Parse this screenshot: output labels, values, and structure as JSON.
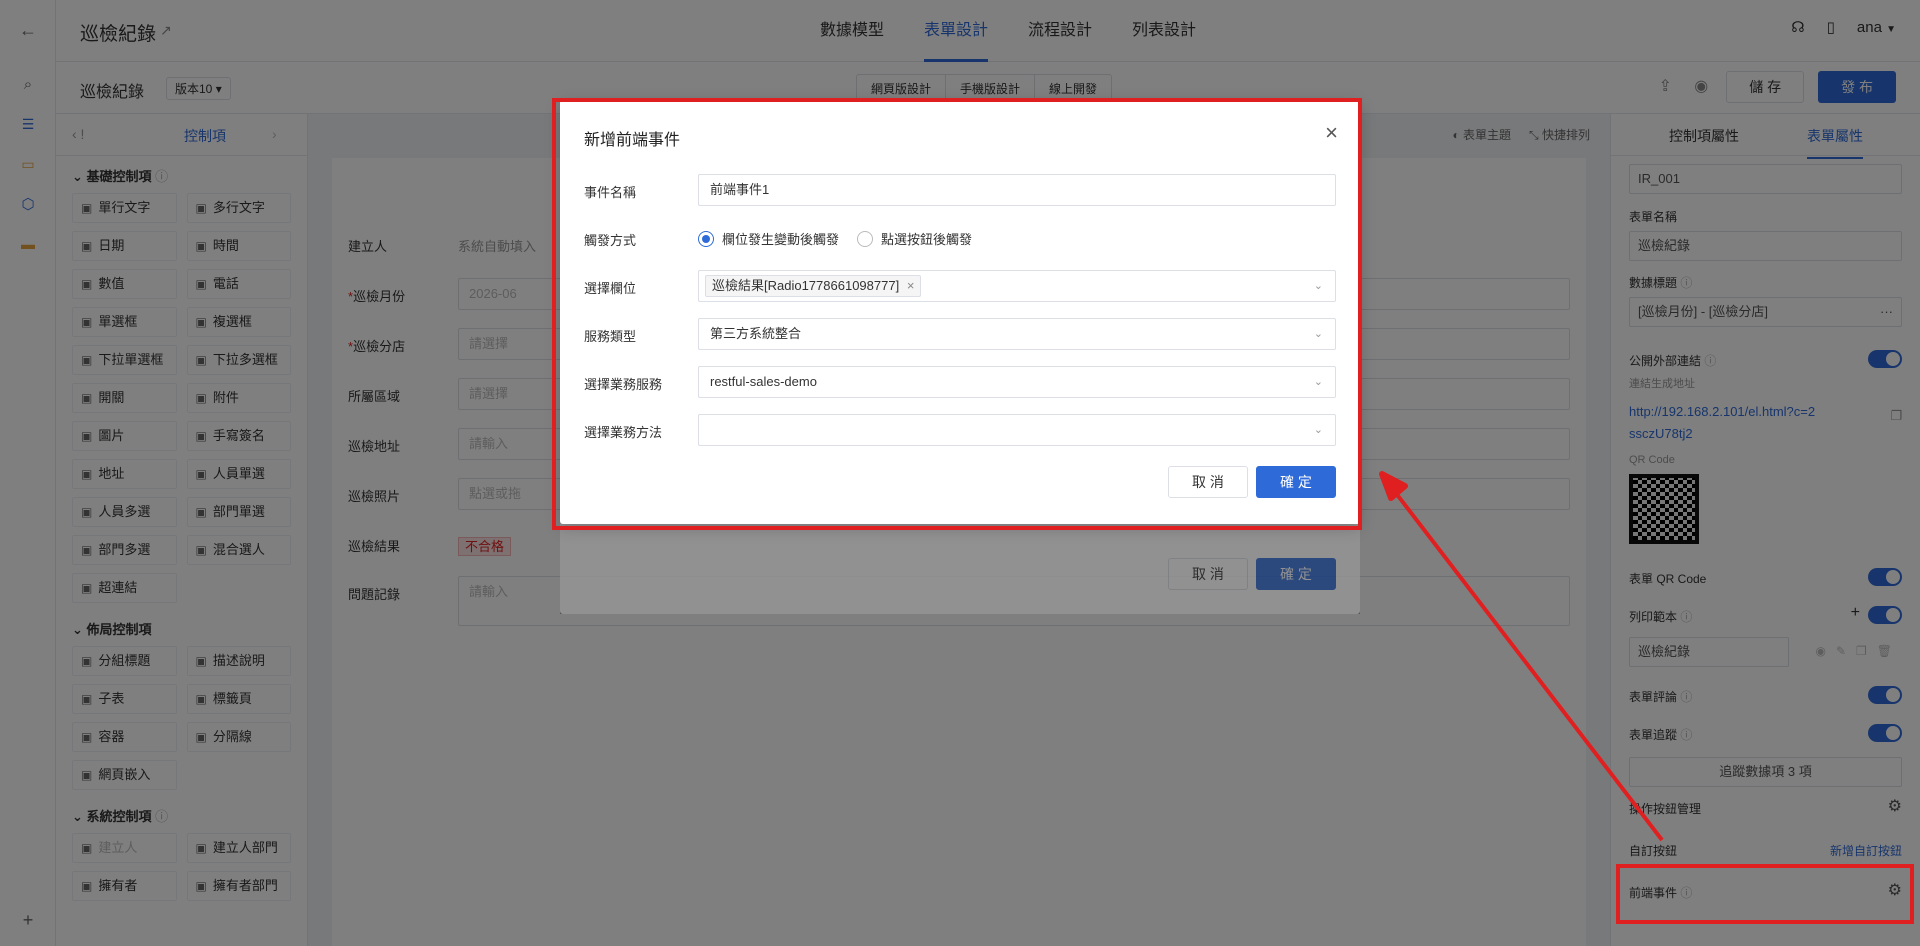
{
  "rail": {
    "icons": [
      "back-arrow-icon",
      "search-icon",
      "list-icon",
      "chat-icon",
      "cube-icon",
      "folder-icon",
      "plus-icon"
    ]
  },
  "header": {
    "title": "巡檢紀錄",
    "tabs": [
      "數據模型",
      "表單設計",
      "流程設計",
      "列表設計"
    ],
    "active_tab": "表單設計",
    "user": "ana"
  },
  "subbar": {
    "form_title": "巡檢紀錄",
    "version": "版本10",
    "device_modes": [
      "網頁版設計",
      "手機版設計",
      "線上開發"
    ],
    "save_label": "儲 存",
    "publish_label": "發 布"
  },
  "left_panel": {
    "tab": "控制項",
    "basic_title": "基礎控制項",
    "basic_controls": [
      "單行文字",
      "多行文字",
      "日期",
      "時間",
      "數值",
      "電話",
      "單選框",
      "複選框",
      "下拉單選框",
      "下拉多選框",
      "開關",
      "附件",
      "圖片",
      "手寫簽名",
      "地址",
      "人員單選",
      "人員多選",
      "部門單選",
      "部門多選",
      "混合選人",
      "超連結"
    ],
    "layout_title": "佈局控制項",
    "layout_controls": [
      "分組標題",
      "描述說明",
      "子表",
      "標籤頁",
      "容器",
      "分隔線",
      "網頁嵌入"
    ],
    "system_title": "系統控制項",
    "system_controls": [
      "建立人",
      "建立人部門",
      "擁有者",
      "擁有者部門"
    ]
  },
  "canvas": {
    "toolbar": [
      "表單主題",
      "快捷排列"
    ],
    "rows": [
      {
        "label": "建立人",
        "value": "系統自動填入",
        "required": false,
        "kind": "plain"
      },
      {
        "label": "巡檢月份",
        "value": "2026-06",
        "required": true,
        "kind": "field"
      },
      {
        "label": "巡檢分店",
        "value": "請選擇",
        "required": true,
        "kind": "field"
      },
      {
        "label": "所屬區域",
        "value": "請選擇",
        "required": false,
        "kind": "field"
      },
      {
        "label": "巡檢地址",
        "value": "請輸入",
        "required": false,
        "kind": "field"
      },
      {
        "label": "巡檢照片",
        "value": "點選或拖",
        "required": false,
        "kind": "field"
      },
      {
        "label": "巡檢結果",
        "value": "不合格",
        "required": false,
        "kind": "plain"
      },
      {
        "label": "問題記錄",
        "value": "請輸入",
        "required": false,
        "kind": "field"
      }
    ]
  },
  "right_panel": {
    "tabs": [
      "控制項屬性",
      "表單屬性"
    ],
    "active_tab": "表單屬性",
    "form_code": "IR_001",
    "form_name_label": "表單名稱",
    "form_name": "巡檢紀錄",
    "data_title_label": "數據標題",
    "data_title": "[巡檢月份] - [巡檢分店]",
    "public_link_label": "公開外部連結",
    "public_link_hint": "連結生成地址",
    "public_link": "http://192.168.2.101/el.html?c=2ssczU78tj2",
    "qr_label": "QR Code",
    "form_qr_label": "表單 QR Code",
    "print_template_label": "列印範本",
    "print_template": "巡檢紀錄",
    "comment_label": "表單評論",
    "trace_label": "表單追蹤",
    "trace_items": "追蹤數據項 3 項",
    "button_mgmt_label": "操作按鈕管理",
    "custom_button_label": "自訂按鈕",
    "add_custom_button": "新增自訂按鈕",
    "frontend_event_label": "前端事件"
  },
  "bg_modal": {
    "cancel": "取 消",
    "ok": "確 定"
  },
  "modal": {
    "title": "新增前端事件",
    "event_name_label": "事件名稱",
    "event_name": "前端事件1",
    "trigger_label": "觸發方式",
    "trigger_options": [
      "欄位發生變動後觸發",
      "點選按鈕後觸發"
    ],
    "trigger_selected": "欄位發生變動後觸發",
    "field_label": "選擇欄位",
    "field_tag": "巡檢結果[Radio1778661098777]",
    "service_type_label": "服務類型",
    "service_type": "第三方系統整合",
    "business_service_label": "選擇業務服務",
    "business_service": "restful-sales-demo",
    "business_method_label": "選擇業務方法",
    "business_method": "",
    "cancel": "取 消",
    "ok": "確 定"
  },
  "colors": {
    "accent": "#2f6bd8",
    "annotation": "#e02020"
  }
}
